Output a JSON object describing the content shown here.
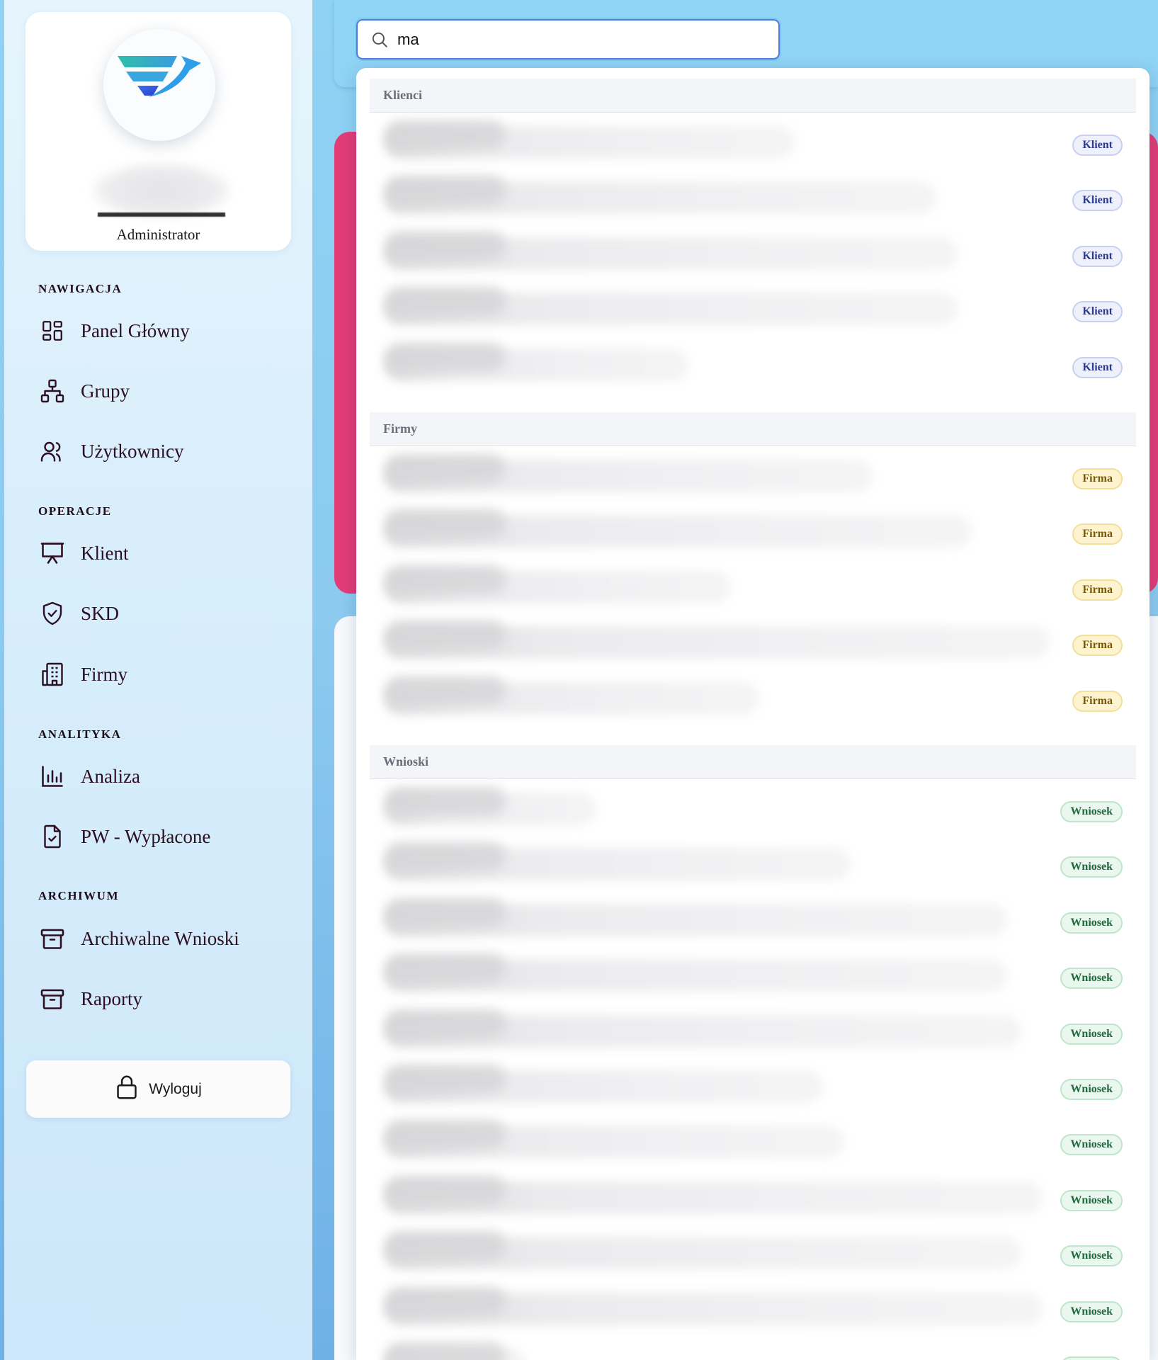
{
  "profile": {
    "role": "Administrator"
  },
  "sidebar": {
    "sections": [
      {
        "title": "NAWIGACJA"
      },
      {
        "title": "OPERACJE"
      },
      {
        "title": "ANALITYKA"
      },
      {
        "title": "ARCHIWUM"
      }
    ],
    "items": [
      {
        "label": "Panel Główny",
        "icon": "dashboard-icon"
      },
      {
        "label": "Grupy",
        "icon": "hierarchy-icon"
      },
      {
        "label": "Użytkownicy",
        "icon": "users-icon"
      },
      {
        "label": "Klient",
        "icon": "presentation-icon"
      },
      {
        "label": "SKD",
        "icon": "shield-check-icon"
      },
      {
        "label": "Firmy",
        "icon": "building-icon"
      },
      {
        "label": "Analiza",
        "icon": "bar-chart-icon"
      },
      {
        "label": "PW - Wypłacone",
        "icon": "document-check-icon"
      },
      {
        "label": "Archiwalne Wnioski",
        "icon": "archive-icon"
      },
      {
        "label": "Raporty",
        "icon": "archive-icon"
      }
    ],
    "logout_label": "Wyloguj"
  },
  "search": {
    "value": "ma"
  },
  "results": {
    "groups": [
      {
        "title": "Klienci",
        "badge": "Klient",
        "count": 5
      },
      {
        "title": "Firmy",
        "badge": "Firma",
        "count": 5
      },
      {
        "title": "Wnioski",
        "badge": "Wniosek",
        "count": 11
      }
    ]
  },
  "colors": {
    "accent_pink": "#e23c76",
    "search_border": "#4c7ee0",
    "badge_klient": "#2d3b8f",
    "badge_firma": "#7a5a07",
    "badge_wniosek": "#1f6a3c"
  }
}
